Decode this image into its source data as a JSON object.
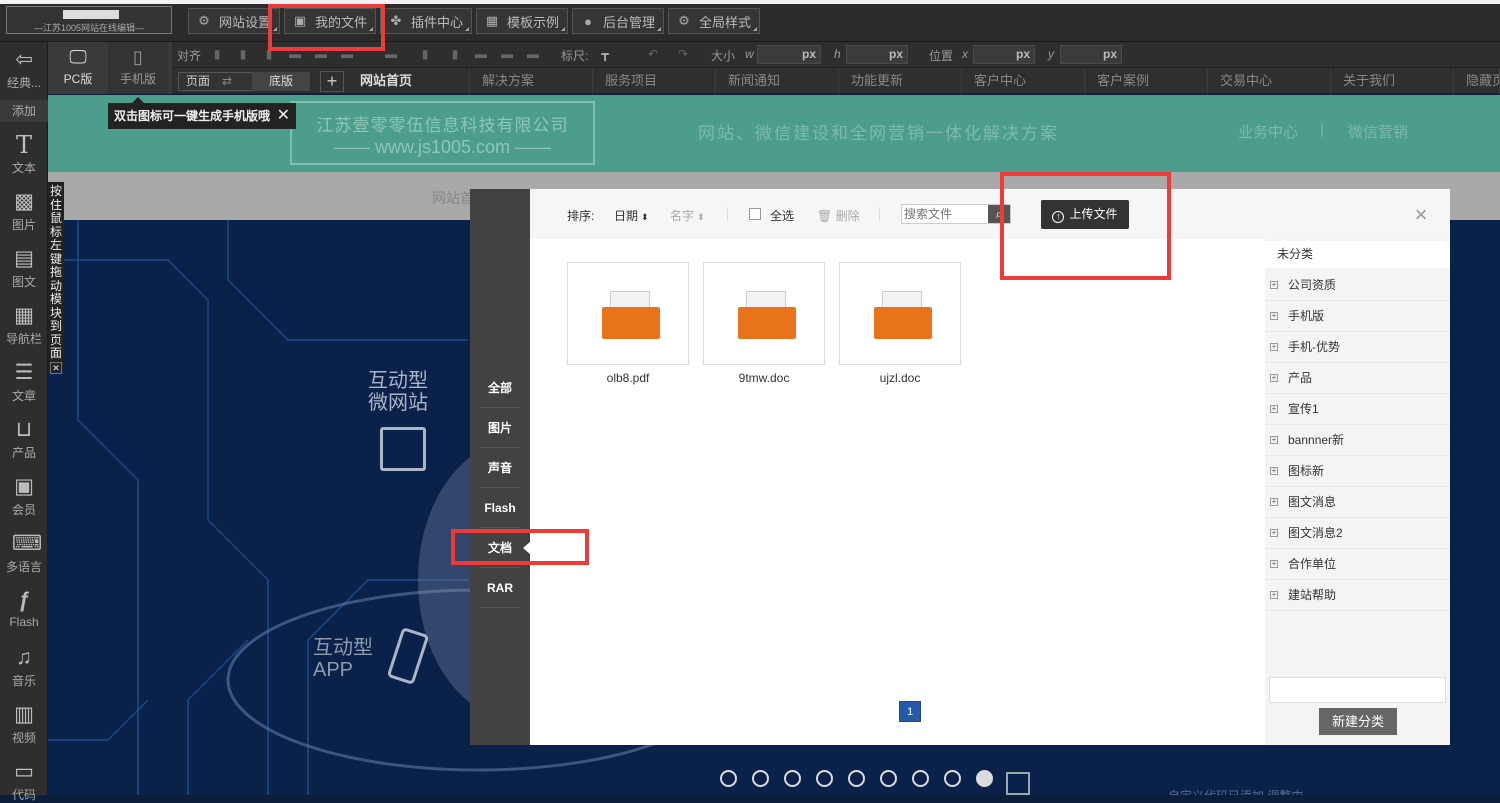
{
  "topbar": {
    "menus": [
      {
        "label": "网站设置",
        "icon": "gear-icon"
      },
      {
        "label": "我的文件",
        "icon": "briefcase-icon"
      },
      {
        "label": "插件中心",
        "icon": "plugin-icon"
      },
      {
        "label": "模板示例",
        "icon": "grid-icon"
      },
      {
        "label": "后台管理",
        "icon": "user-icon"
      },
      {
        "label": "全局样式",
        "icon": "gear-icon"
      }
    ]
  },
  "toolbar": {
    "align_label": "对齐",
    "ruler_label": "标尺:",
    "size_label": "大小",
    "w": "w",
    "h": "h",
    "position_label": "位置",
    "x": "x",
    "y": "y",
    "px": "px"
  },
  "left_tools": [
    {
      "label": "经典...",
      "icon": "exit-icon"
    },
    {
      "label": "添加",
      "icon": ""
    },
    {
      "label": "文本",
      "icon": "text-icon"
    },
    {
      "label": "图片",
      "icon": "image-icon"
    },
    {
      "label": "图文",
      "icon": "doc-icon"
    },
    {
      "label": "导航栏",
      "icon": "nav-icon"
    },
    {
      "label": "文章",
      "icon": "article-icon"
    },
    {
      "label": "产品",
      "icon": "basket-icon"
    },
    {
      "label": "会员",
      "icon": "member-icon"
    },
    {
      "label": "多语言",
      "icon": "keyboard-icon"
    },
    {
      "label": "Flash",
      "icon": "flash-icon"
    },
    {
      "label": "音乐",
      "icon": "music-icon"
    },
    {
      "label": "视频",
      "icon": "film-icon"
    },
    {
      "label": "代码",
      "icon": "code-icon"
    }
  ],
  "device": {
    "pc": "PC版",
    "mobile": "手机版"
  },
  "page_tabs": {
    "page": "页面",
    "bottom": "底版",
    "add": "+"
  },
  "nav_items": [
    "网站首页",
    "解决方案",
    "服务项目",
    "新闻通知",
    "功能更新",
    "客户中心",
    "客户案例",
    "交易中心",
    "关于我们",
    "隐藏页"
  ],
  "tooltip": "双击图标可一键生成手机版哦",
  "drag_hint": [
    "按",
    "住",
    "鼠",
    "标",
    "左",
    "键",
    "拖",
    "动",
    "模",
    "块",
    "到",
    "页",
    "面"
  ],
  "canvas": {
    "company": "江苏壹零零伍信息科技有限公司",
    "site": "www.js1005.com",
    "slogan": "网站、微信建设和全网营销一体化解决方案",
    "link1": "业务中心",
    "link_sep": "|",
    "link2": "微信营销",
    "nav_home": "网站首",
    "hero_t1a": "互动型",
    "hero_t1b": "微网站",
    "hero_t2a": "互动型",
    "hero_t2b": "APP",
    "bottom_hint": "自定义代码已添加 调整中"
  },
  "dialog": {
    "sort_label": "排序:",
    "sort_date": "日期",
    "sort_name": "名字",
    "select_all": "全选",
    "delete": "删除",
    "search_placeholder": "搜索文件",
    "upload": "上传文件",
    "tabs": [
      "全部",
      "图片",
      "声音",
      "Flash",
      "文档",
      "RAR"
    ],
    "files": [
      {
        "name": "olb8.pdf"
      },
      {
        "name": "9tmw.doc"
      },
      {
        "name": "ujzl.doc"
      }
    ],
    "categories_header": "未分类",
    "categories": [
      "公司资质",
      "手机版",
      "手机-优势",
      "产品",
      "宣传1",
      "bannner新",
      "图标新",
      "图文消息",
      "图文消息2",
      "合作单位",
      "建站帮助"
    ],
    "new_category": "新建分类",
    "page": "1",
    "close": "×"
  },
  "colors": {
    "accent_red": "#ef3a3a",
    "header_teal": "#4d9d8c",
    "upload_bg": "#333333",
    "page_blue": "#2659a6"
  }
}
